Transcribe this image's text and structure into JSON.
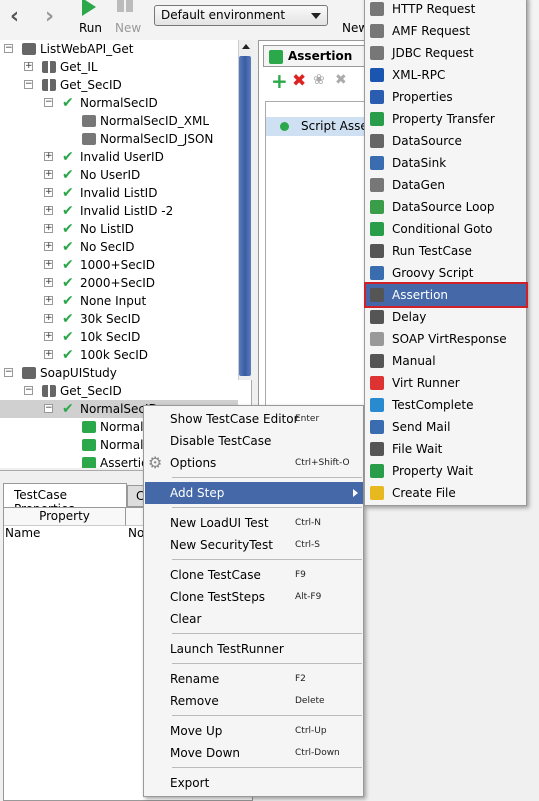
{
  "toolbar": {
    "back_icon": "chevron-left",
    "forward_icon": "chevron-right",
    "run": "Run",
    "new": "New",
    "environment": "Default environment",
    "new2": "New"
  },
  "tree": [
    {
      "label": "ListWebAPI_Get",
      "level": 0,
      "icon": "folder",
      "exp": "-"
    },
    {
      "label": "Get_IL",
      "level": 1,
      "icon": "suite",
      "exp": "+"
    },
    {
      "label": "Get_SecID",
      "level": 1,
      "icon": "suite",
      "exp": "-"
    },
    {
      "label": "NormalSecID",
      "level": 2,
      "icon": "check",
      "exp": "-"
    },
    {
      "label": "NormalSecID_XML",
      "level": 3,
      "icon": "rest"
    },
    {
      "label": "NormalSecID_JSON",
      "level": 3,
      "icon": "rest"
    },
    {
      "label": "Invalid UserID",
      "level": 2,
      "icon": "check",
      "exp": "+"
    },
    {
      "label": "No UserID",
      "level": 2,
      "icon": "check",
      "exp": "+"
    },
    {
      "label": "Invalid ListID",
      "level": 2,
      "icon": "check",
      "exp": "+"
    },
    {
      "label": "Invalid ListID -2",
      "level": 2,
      "icon": "check",
      "exp": "+"
    },
    {
      "label": "No ListID",
      "level": 2,
      "icon": "check",
      "exp": "+"
    },
    {
      "label": "No SecID",
      "level": 2,
      "icon": "check",
      "exp": "+"
    },
    {
      "label": "1000+SecID",
      "level": 2,
      "icon": "check",
      "exp": "+"
    },
    {
      "label": "2000+SecID",
      "level": 2,
      "icon": "check",
      "exp": "+"
    },
    {
      "label": "None Input",
      "level": 2,
      "icon": "check",
      "exp": "+"
    },
    {
      "label": "30k SecID",
      "level": 2,
      "icon": "check",
      "exp": "+"
    },
    {
      "label": "10k SecID",
      "level": 2,
      "icon": "check",
      "exp": "+"
    },
    {
      "label": "100k SecID",
      "level": 2,
      "icon": "check",
      "exp": "+"
    },
    {
      "label": "SoapUIStudy",
      "level": 0,
      "icon": "folder",
      "exp": "-"
    },
    {
      "label": "Get_SecID",
      "level": 1,
      "icon": "suite",
      "exp": "-"
    },
    {
      "label": "NormalSecID",
      "level": 2,
      "icon": "check",
      "exp": "-",
      "selected": true
    },
    {
      "label": "NormalS",
      "level": 3,
      "icon": "rest"
    },
    {
      "label": "NormalS",
      "level": 3,
      "icon": "rest"
    },
    {
      "label": "Assertio",
      "level": 3,
      "icon": "assertion"
    }
  ],
  "bottom": {
    "tab1": "TestCase Properties",
    "tab2": "C",
    "col1": "Property",
    "row_name": "Name",
    "row_value": "No"
  },
  "editor": {
    "tab": "Assertion",
    "item": "Script Asse"
  },
  "context_menu": [
    {
      "label": "Show TestCase Editor",
      "key": "Enter"
    },
    {
      "label": "Disable TestCase",
      "key": ""
    },
    {
      "label": "Options",
      "key": "Ctrl+Shift-O",
      "icon": "gear"
    },
    {
      "sep": true
    },
    {
      "label": "Add Step",
      "key": "",
      "submenu": true,
      "highlighted": true
    },
    {
      "sep": true
    },
    {
      "label": "New LoadUI Test",
      "key": "Ctrl-N"
    },
    {
      "label": "New SecurityTest",
      "key": "Ctrl-S"
    },
    {
      "sep": true
    },
    {
      "label": "Clone TestCase",
      "key": "F9"
    },
    {
      "label": "Clone TestSteps",
      "key": "Alt-F9"
    },
    {
      "label": "Clear",
      "key": ""
    },
    {
      "sep": true
    },
    {
      "label": "Launch TestRunner",
      "key": ""
    },
    {
      "sep": true
    },
    {
      "label": "Rename",
      "key": "F2"
    },
    {
      "label": "Remove",
      "key": "Delete"
    },
    {
      "sep": true
    },
    {
      "label": "Move Up",
      "key": "Ctrl-Up"
    },
    {
      "label": "Move Down",
      "key": "Ctrl-Down"
    },
    {
      "sep": true
    },
    {
      "label": "Export",
      "key": ""
    }
  ],
  "submenu": [
    {
      "label": "HTTP Request",
      "icon": "http",
      "color": "#777777"
    },
    {
      "label": "AMF Request",
      "icon": "amf",
      "color": "#777777"
    },
    {
      "label": "JDBC Request",
      "icon": "jdbc",
      "color": "#777777"
    },
    {
      "label": "XML-RPC",
      "icon": "xmlrpc",
      "color": "#1a56b0"
    },
    {
      "label": "Properties",
      "icon": "properties",
      "color": "#2a5db0"
    },
    {
      "label": "Property Transfer",
      "icon": "transfer",
      "color": "#2a9d4a"
    },
    {
      "label": "DataSource",
      "icon": "datasource",
      "color": "#666666"
    },
    {
      "label": "DataSink",
      "icon": "datasink",
      "color": "#3a6cb0"
    },
    {
      "label": "DataGen",
      "icon": "datagen",
      "color": "#777777"
    },
    {
      "label": "DataSource Loop",
      "icon": "loop",
      "color": "#3a9d4a"
    },
    {
      "label": "Conditional Goto",
      "icon": "goto",
      "color": "#2a9d4a"
    },
    {
      "label": "Run TestCase",
      "icon": "run-testcase",
      "color": "#555555"
    },
    {
      "label": "Groovy Script",
      "icon": "star",
      "color": "#3a6cb0"
    },
    {
      "label": "Assertion",
      "icon": "assertion",
      "color": "#555555",
      "highlighted": true
    },
    {
      "label": "Delay",
      "icon": "clock",
      "color": "#555555"
    },
    {
      "label": "SOAP VirtResponse",
      "icon": "soap",
      "color": "#999999"
    },
    {
      "label": "Manual",
      "icon": "manual",
      "color": "#555555"
    },
    {
      "label": "Virt Runner",
      "icon": "virt-runner",
      "color": "#d33"
    },
    {
      "label": "TestComplete",
      "icon": "testcomplete",
      "color": "#2a8ad0"
    },
    {
      "label": "Send Mail",
      "icon": "mail",
      "color": "#3a6cb0"
    },
    {
      "label": "File Wait",
      "icon": "file-wait",
      "color": "#555555"
    },
    {
      "label": "Property Wait",
      "icon": "property-wait",
      "color": "#2a9d4a"
    },
    {
      "label": "Create File",
      "icon": "create-file",
      "color": "#e8b820"
    }
  ],
  "colors": {
    "highlight": "#4569a8",
    "accent_green": "#2aa84a",
    "outline_red": "#d0202a"
  }
}
